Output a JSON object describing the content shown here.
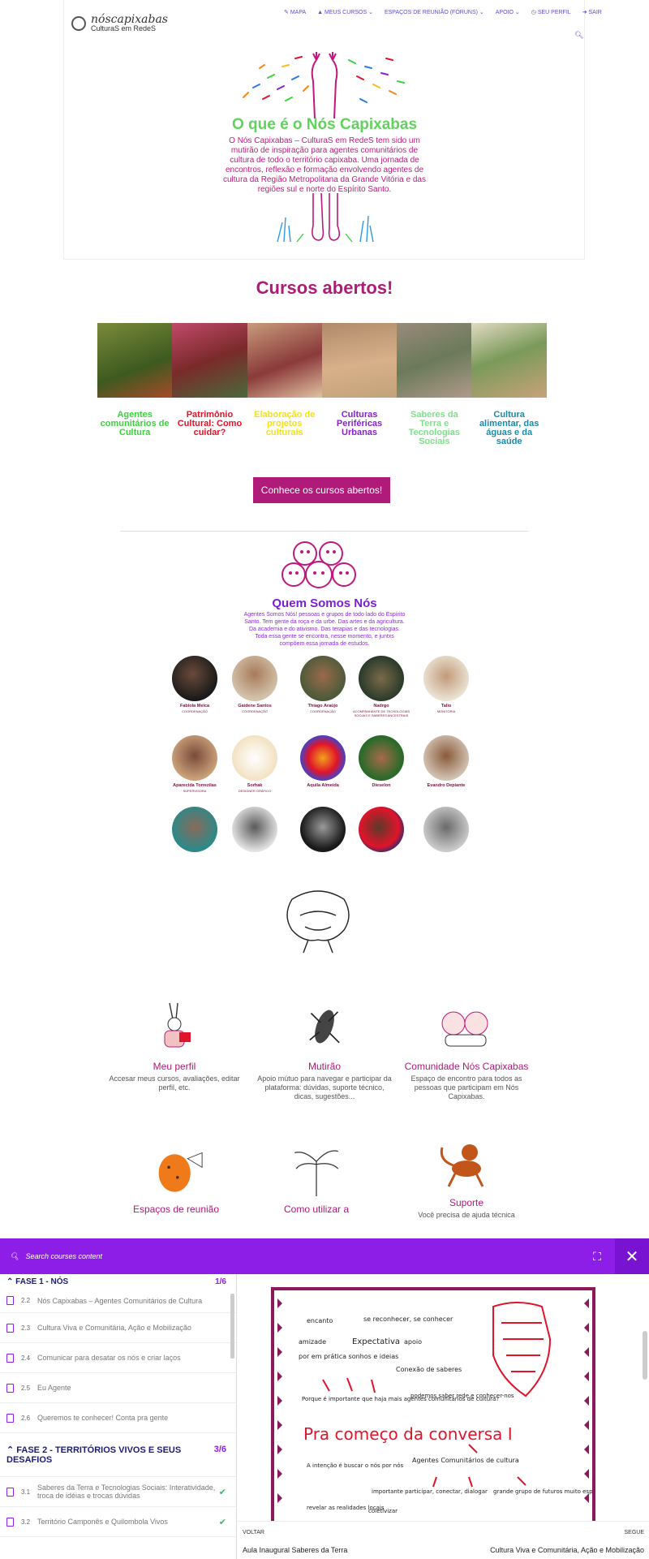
{
  "header": {
    "logo_title": "nóscapixabas",
    "logo_sub": "CulturaS em RedeS",
    "nav": [
      "MAPA",
      "MEUS CURSOS",
      "ESPAÇOS DE REUNIÃO (FÓRUNS)",
      "APOIO",
      "SEU PERFIL",
      "SAIR"
    ]
  },
  "hero": {
    "title": "O que é o Nós Capixabas",
    "text": "O Nós Capixabas – CulturaS em RedeS tem sido um mutirão de inspiração para agentes comunitários de cultura de todo o território capixaba. Uma jornada de encontros, reflexão e formação envolvendo agentes de cultura da Região Metropolitana da Grande Vitória e das regiões sul e norte do Espírito Santo."
  },
  "courses": {
    "title": "Cursos abertos!",
    "items": [
      {
        "name": "Agentes comunitários de Cultura",
        "color": "#3ad33a"
      },
      {
        "name": "Patrimônio Cultural: Como cuidar?",
        "color": "#e0142a"
      },
      {
        "name": "Elaboração de projetos culturais",
        "color": "#f2e01a"
      },
      {
        "name": "Culturas Periféricas Urbanas",
        "color": "#8a1fd6"
      },
      {
        "name": "Saberes da Terra e Tecnologias Sociais",
        "color": "#7ee08a"
      },
      {
        "name": "Cultura alimentar, das águas e da saúde",
        "color": "#1a8aa8"
      }
    ],
    "cta": "Conhece os cursos abertos!"
  },
  "about": {
    "title": "Quem Somos Nós",
    "text": "Agentes Somos Nós! pessoas e grupos de todo lado do Espírito Santo. Tem gente da roça e da urbe. Das artes e da agricultura. Da academia e do ativismo. Das terapias e das tecnologias. Toda essa gente se encontra, nesse momento, e juntxs compõem essa jornada de estudos."
  },
  "team": [
    {
      "name": "Fabiola Melca",
      "role": "COORDENAÇÃO"
    },
    {
      "name": "Gaidene Santos",
      "role": "COORDENAÇÃO"
    },
    {
      "name": "Thiago Araújo",
      "role": "COORDENAÇÃO"
    },
    {
      "name": "Nadrgo",
      "role": "ACOMPANHANTE DE TECNOLOGIAS SOCIAIS E SABERES ANCESTRAIS"
    },
    {
      "name": "Talio",
      "role": "MONITORIA"
    },
    {
      "name": "Aparecida Torrezilas",
      "role": "SUPERVISORA"
    },
    {
      "name": "Sorhak",
      "role": "DESIGNER GRÁFICO"
    },
    {
      "name": "Aquila Almeida",
      "role": ""
    },
    {
      "name": "Dieselon",
      "role": ""
    },
    {
      "name": "Evandro Depiante",
      "role": ""
    },
    {
      "name": "",
      "role": ""
    },
    {
      "name": "",
      "role": ""
    },
    {
      "name": "",
      "role": ""
    },
    {
      "name": "",
      "role": ""
    },
    {
      "name": "",
      "role": ""
    }
  ],
  "features": [
    {
      "title": "Meu perfil",
      "desc": "Accesar meus cursos, avaliações, editar perfil, etc."
    },
    {
      "title": "Mutirão",
      "desc": "Apoio mútuo para navegar e participar da plataforma: dúvidas, suporte técnico, dicas, sugestões..."
    },
    {
      "title": "Comunidade Nós Capixabas",
      "desc": "Espaço de encontro para todos as pessoas que participam em Nós Capixabas."
    },
    {
      "title": "Espaços de reunião",
      "desc": ""
    },
    {
      "title": "Como utilizar a",
      "desc": ""
    },
    {
      "title": "Suporte",
      "desc": "Você precisa de ajuda técnica"
    }
  ],
  "overlay": {
    "search_placeholder": "Search courses content",
    "phase1": {
      "title": "FASE 1 - NÓS",
      "count": "1/6"
    },
    "lessons1": [
      {
        "no": "2.2",
        "title": "Nós Capixabas – Agentes Comunitários de Cultura"
      },
      {
        "no": "2.3",
        "title": "Cultura Viva e Comunitária, Ação e Mobilização"
      },
      {
        "no": "2.4",
        "title": "Comunicar para desatar os nós e criar laços"
      },
      {
        "no": "2.5",
        "title": "Eu Agente"
      },
      {
        "no": "2.6",
        "title": "Queremos te conhecer! Conta pra gente"
      }
    ],
    "phase2": {
      "title": "FASE 2 - TERRITÓRIOS VIVOS E SEUS DESAFIOS",
      "count": "3/6"
    },
    "lessons2": [
      {
        "no": "3.1",
        "title": "Saberes da Terra e Tecnologias Sociais: Interatividade, troca de idéias e trocas dúvidas"
      },
      {
        "no": "3.2",
        "title": "Território Camponês e Quilombola Vivos"
      }
    ],
    "prev_label": "VOLTAR",
    "prev_title": "Aula Inaugural Saberes da Terra",
    "next_label": "SEGUE",
    "next_title": "Cultura Viva e Comunitária, Ação e Mobilização"
  },
  "poster": {
    "heading": "Pra começo da conversa I",
    "words": [
      "encanto",
      "amizade",
      "por em prática sonhos e ideias",
      "Expectativa",
      "se reconhecer, se conhecer",
      "apoio",
      "Conexão de saberes",
      "Porque é importante que haja mais agentes comunitários de cultura?",
      "podemos saber rede e conhecer-nos",
      "A intenção é buscar o nós por nós",
      "Agentes Comunitários de cultura",
      "importante participar, conectar, dialogar",
      "grande grupo de futuros muito especiais",
      "revelar as realidades locais",
      "coletivizar"
    ]
  },
  "colors": {
    "brand": "#b01a78",
    "overlay": "#8c1ee8"
  }
}
